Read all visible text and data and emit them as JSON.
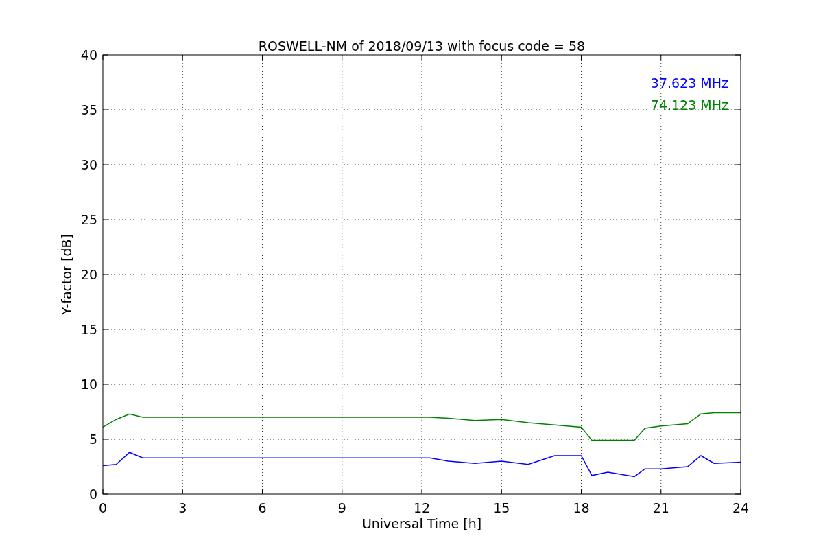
{
  "chart": {
    "chart_data": {
      "type": "line",
      "title": "ROSWELL-NM of 2018/09/13 with focus code = 58",
      "xlabel": "Universal Time [h]",
      "ylabel": "Y-factor [dB]",
      "x": [
        0,
        0.5,
        1,
        1.5,
        3,
        6,
        9,
        12.3,
        13,
        14,
        15,
        16,
        17,
        18,
        18.4,
        19,
        20,
        20.4,
        21,
        22,
        22.5,
        23,
        24
      ],
      "series": [
        {
          "name": "37.623 MHz",
          "color": "#0000ff",
          "values": [
            2.6,
            2.7,
            3.8,
            3.3,
            3.3,
            3.3,
            3.3,
            3.3,
            3.0,
            2.8,
            3.0,
            2.7,
            3.5,
            3.5,
            1.7,
            2.0,
            1.6,
            2.3,
            2.3,
            2.5,
            3.5,
            2.8,
            2.9
          ]
        },
        {
          "name": "74.123 MHz",
          "color": "#008000",
          "values": [
            6.1,
            6.8,
            7.3,
            7.0,
            7.0,
            7.0,
            7.0,
            7.0,
            6.9,
            6.7,
            6.8,
            6.5,
            6.3,
            6.1,
            4.9,
            4.9,
            4.9,
            6.0,
            6.2,
            6.4,
            7.3,
            7.4,
            7.4
          ]
        }
      ],
      "xlim": [
        0,
        24
      ],
      "ylim": [
        0,
        40
      ],
      "xticks": [
        0,
        3,
        6,
        9,
        12,
        15,
        18,
        21,
        24
      ],
      "yticks": [
        0,
        5,
        10,
        15,
        20,
        25,
        30,
        35,
        40
      ],
      "grid": true
    }
  }
}
